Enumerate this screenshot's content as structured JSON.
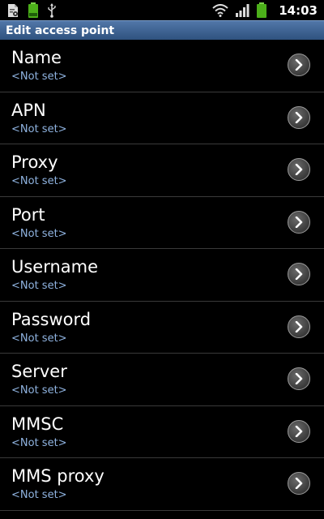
{
  "status_bar": {
    "time": "14:03",
    "icons": {
      "left": [
        "document-settings-icon",
        "battery-charging-icon",
        "usb-icon"
      ],
      "right": [
        "wifi-icon",
        "signal-icon",
        "battery-icon"
      ]
    },
    "colors": {
      "battery": "#4caf1a",
      "background": "#000000"
    }
  },
  "title_bar": {
    "title": "Edit access point",
    "color_top": "#5177a8",
    "color_bottom": "#2f527f"
  },
  "preferences": [
    {
      "title": "Name",
      "summary": "<Not set>"
    },
    {
      "title": "APN",
      "summary": "<Not set>"
    },
    {
      "title": "Proxy",
      "summary": "<Not set>"
    },
    {
      "title": "Port",
      "summary": "<Not set>"
    },
    {
      "title": "Username",
      "summary": "<Not set>"
    },
    {
      "title": "Password",
      "summary": "<Not set>"
    },
    {
      "title": "Server",
      "summary": "<Not set>"
    },
    {
      "title": "MMSC",
      "summary": "<Not set>"
    },
    {
      "title": "MMS proxy",
      "summary": "<Not set>"
    }
  ],
  "colors": {
    "summary_text": "#8fb3e0",
    "divider": "#3a3a3a"
  }
}
